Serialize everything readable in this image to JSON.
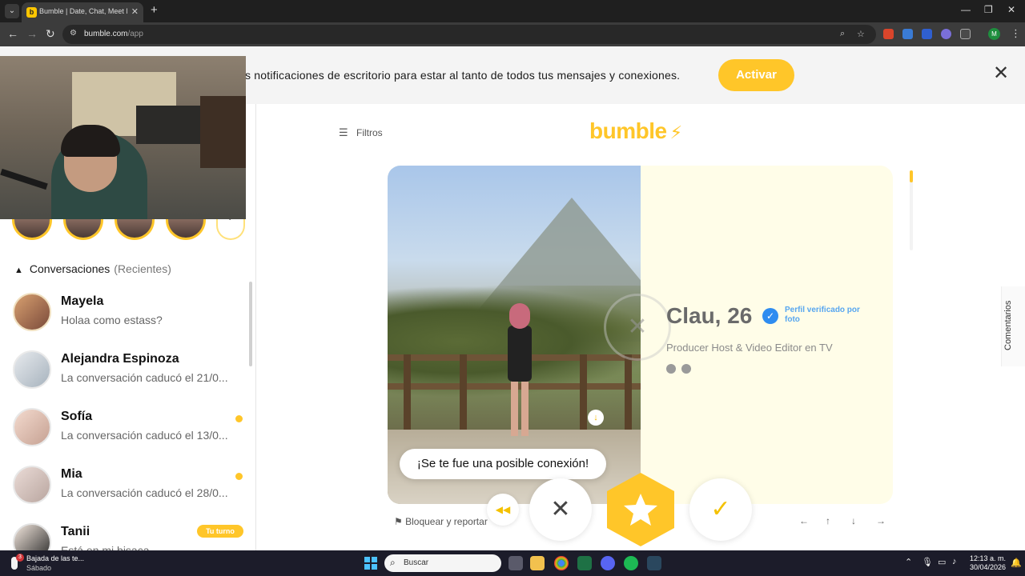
{
  "browser": {
    "tab_title": "Bumble | Date, Chat, Meet New",
    "url_host": "bumble.com",
    "url_path": "/app"
  },
  "banner": {
    "text": "s notificaciones de escritorio para estar al tanto de todos tus mensajes y conexiones.",
    "button": "Activar"
  },
  "header": {
    "filters": "Filtros",
    "logo": "bumble"
  },
  "sidebar": {
    "conversations_title": "Conversaciones",
    "conversations_filter": "(Recientes)",
    "conversations": [
      {
        "name": "Mayela",
        "message": "Holaa como estass?",
        "unread": false,
        "badge": ""
      },
      {
        "name": "Alejandra Espinoza",
        "message": "La conversación caducó el 21/0...",
        "unread": false,
        "badge": ""
      },
      {
        "name": "Sofía",
        "message": "La conversación caducó el 13/0...",
        "unread": true,
        "badge": ""
      },
      {
        "name": "Mia",
        "message": "La conversación caducó el 28/0...",
        "unread": true,
        "badge": ""
      },
      {
        "name": "Tanii",
        "message": "Está en mi bisaca",
        "unread": false,
        "badge": "Tu turno"
      }
    ]
  },
  "profile": {
    "name_age": "Clau, 26",
    "verified_label": "Perfil verificado por foto",
    "job": "Producer Host & Video Editor en TV",
    "photo_progress": 0.15
  },
  "toast": "¡Se te fue una posible conexión!",
  "actions": {
    "block_report": "Bloquear y reportar",
    "nope_glyph": "✕",
    "like_glyph": "✓",
    "rewind_glyph": "◀◀"
  },
  "side_tab": "Comentarios",
  "keyboard_hints": [
    "←",
    "↑",
    "↓",
    "→"
  ],
  "taskbar": {
    "weather_title": "Bajada de las te...",
    "weather_sub": "Sábado",
    "weather_badge": "3",
    "search": "Buscar",
    "time": "12:13 a. m.",
    "date": "30/04/2026"
  },
  "colors": {
    "brand": "#ffc629",
    "verified": "#2e8cf0"
  }
}
